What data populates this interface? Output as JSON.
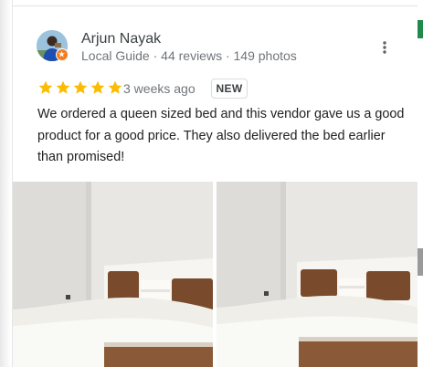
{
  "review": {
    "author": {
      "name": "Arjun Nayak",
      "meta": "Local Guide · 44 reviews · 149 photos",
      "avatar_icon": "user-avatar",
      "badge_icon": "local-guide-badge-icon"
    },
    "menu_icon": "more-vert-icon",
    "rating": {
      "stars": 5,
      "max": 5,
      "star_color": "#fbbc04",
      "star_icon": "star-icon"
    },
    "time": "3 weeks ago",
    "new_label": "NEW",
    "text": "We ordered a queen sized bed and this vendor gave us a good product for a good price. They also delivered the bed earlier than promised!",
    "photos": [
      {
        "icon": "bed-photo"
      },
      {
        "icon": "bed-photo"
      }
    ]
  },
  "colors": {
    "text_primary": "#202124",
    "text_secondary": "#70757a",
    "local_guide_badge": "#f47b20"
  }
}
